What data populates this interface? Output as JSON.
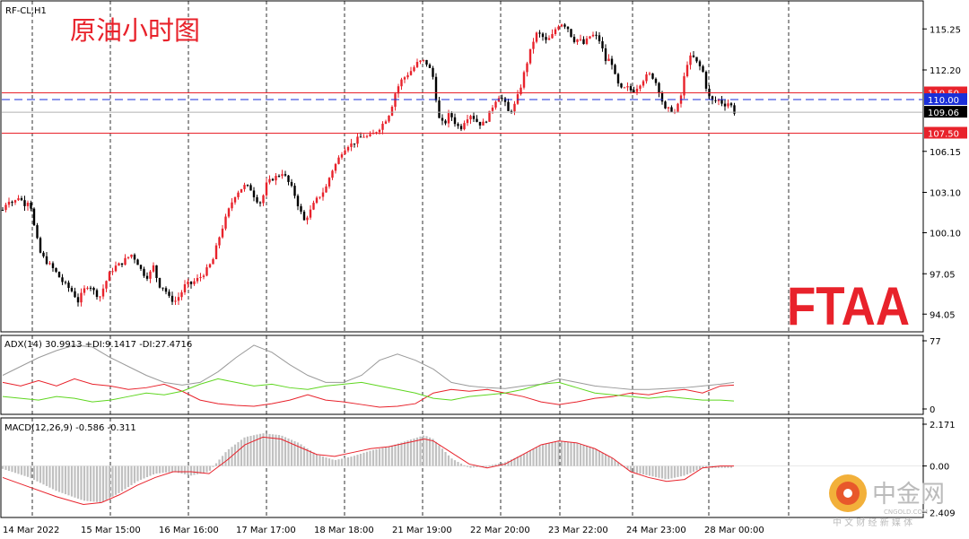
{
  "header": {
    "symbol_label": "RF-CL,H1",
    "chart_title": "原油小时图"
  },
  "watermark": {
    "brand": "FTAA",
    "brand_color": "#e8222b",
    "site_name": "中金网",
    "site_domain": "CNGOLD.COM",
    "site_tagline": "中 文 财 经 新 媒 体"
  },
  "chart_data": [
    {
      "type": "candlestick",
      "panel": "main",
      "ylim": [
        93.0,
        117.0
      ],
      "y_ticks": [
        "115.25",
        "112.20",
        "106.15",
        "103.10",
        "100.10",
        "97.05",
        "94.05"
      ],
      "y_tick_values": [
        115.25,
        112.2,
        106.15,
        103.1,
        100.1,
        97.05,
        94.05
      ],
      "x_tick_labels": [
        "14 Mar 2022",
        "15 Mar 15:00",
        "16 Mar 16:00",
        "17 Mar 17:00",
        "18 Mar 18:00",
        "21 Mar 19:00",
        "22 Mar 20:00",
        "23 Mar 22:00",
        "24 Mar 23:00",
        "28 Mar 00:00"
      ],
      "grid": "vertical-dashed",
      "close_path": [
        [
          0,
          101.8
        ],
        [
          6,
          102.6
        ],
        [
          12,
          102.3
        ],
        [
          18,
          102.8
        ],
        [
          24,
          102.2
        ],
        [
          30,
          102.6
        ],
        [
          36,
          100.2
        ],
        [
          42,
          98.6
        ],
        [
          48,
          98.0
        ],
        [
          54,
          97.6
        ],
        [
          60,
          97.1
        ],
        [
          66,
          96.5
        ],
        [
          72,
          96.1
        ],
        [
          78,
          95.7
        ],
        [
          84,
          95.0
        ],
        [
          90,
          95.8
        ],
        [
          96,
          96.3
        ],
        [
          102,
          95.7
        ],
        [
          108,
          95.3
        ],
        [
          114,
          96.3
        ],
        [
          120,
          97.2
        ],
        [
          126,
          97.6
        ],
        [
          132,
          97.8
        ],
        [
          138,
          98.2
        ],
        [
          144,
          98.5
        ],
        [
          150,
          97.9
        ],
        [
          156,
          97.1
        ],
        [
          162,
          96.8
        ],
        [
          168,
          97.6
        ],
        [
          174,
          96.2
        ],
        [
          180,
          96.0
        ],
        [
          186,
          95.2
        ],
        [
          192,
          95.0
        ],
        [
          198,
          95.5
        ],
        [
          204,
          96.3
        ],
        [
          210,
          96.3
        ],
        [
          216,
          96.6
        ],
        [
          222,
          96.9
        ],
        [
          228,
          97.4
        ],
        [
          234,
          98.0
        ],
        [
          240,
          99.5
        ],
        [
          246,
          100.7
        ],
        [
          252,
          101.8
        ],
        [
          258,
          102.8
        ],
        [
          264,
          103.3
        ],
        [
          270,
          103.6
        ],
        [
          276,
          103.4
        ],
        [
          282,
          102.6
        ],
        [
          288,
          102.3
        ],
        [
          294,
          103.7
        ],
        [
          300,
          104.1
        ],
        [
          306,
          104.3
        ],
        [
          312,
          104.6
        ],
        [
          318,
          103.9
        ],
        [
          324,
          103.2
        ],
        [
          330,
          102.0
        ],
        [
          336,
          101.0
        ],
        [
          342,
          101.6
        ],
        [
          348,
          102.4
        ],
        [
          354,
          102.9
        ],
        [
          360,
          103.4
        ],
        [
          366,
          104.6
        ],
        [
          372,
          105.3
        ],
        [
          378,
          106.1
        ],
        [
          384,
          106.6
        ],
        [
          390,
          106.7
        ],
        [
          396,
          107.1
        ],
        [
          402,
          107.3
        ],
        [
          408,
          107.2
        ],
        [
          414,
          107.5
        ],
        [
          420,
          107.9
        ],
        [
          426,
          108.4
        ],
        [
          432,
          109.1
        ],
        [
          438,
          110.6
        ],
        [
          444,
          111.4
        ],
        [
          450,
          111.8
        ],
        [
          456,
          112.2
        ],
        [
          462,
          112.7
        ],
        [
          468,
          112.9
        ],
        [
          474,
          112.6
        ],
        [
          480,
          111.6
        ],
        [
          486,
          108.6
        ],
        [
          492,
          108.1
        ],
        [
          498,
          109.0
        ],
        [
          504,
          108.3
        ],
        [
          510,
          107.8
        ],
        [
          516,
          108.6
        ],
        [
          522,
          108.9
        ],
        [
          528,
          108.4
        ],
        [
          534,
          108.1
        ],
        [
          540,
          108.6
        ],
        [
          546,
          109.5
        ],
        [
          552,
          110.3
        ],
        [
          558,
          110.0
        ],
        [
          564,
          109.0
        ],
        [
          570,
          109.5
        ],
        [
          576,
          110.6
        ],
        [
          582,
          112.2
        ],
        [
          588,
          113.6
        ],
        [
          594,
          114.9
        ],
        [
          600,
          114.8
        ],
        [
          606,
          114.3
        ],
        [
          612,
          114.7
        ],
        [
          618,
          115.5
        ],
        [
          624,
          115.7
        ],
        [
          630,
          115.3
        ],
        [
          636,
          114.4
        ],
        [
          642,
          114.5
        ],
        [
          648,
          114.1
        ],
        [
          654,
          114.7
        ],
        [
          660,
          114.8
        ],
        [
          666,
          114.3
        ],
        [
          672,
          112.9
        ],
        [
          678,
          113.0
        ],
        [
          684,
          111.3
        ],
        [
          690,
          110.7
        ],
        [
          696,
          110.9
        ],
        [
          702,
          110.6
        ],
        [
          708,
          111.0
        ],
        [
          714,
          111.5
        ],
        [
          720,
          111.9
        ],
        [
          726,
          111.6
        ],
        [
          732,
          110.6
        ],
        [
          738,
          109.2
        ],
        [
          744,
          109.3
        ],
        [
          750,
          109.0
        ],
        [
          756,
          110.3
        ],
        [
          762,
          112.6
        ],
        [
          768,
          113.3
        ],
        [
          774,
          112.7
        ],
        [
          780,
          112.2
        ],
        [
          786,
          110.3
        ],
        [
          792,
          109.8
        ],
        [
          798,
          110.0
        ],
        [
          804,
          109.6
        ],
        [
          810,
          109.8
        ],
        [
          816,
          109.0
        ]
      ],
      "hlines": [
        {
          "label": "110.50",
          "value": 110.5,
          "color": "#e8222b",
          "style": "solid"
        },
        {
          "label": "110.00",
          "value": 110.0,
          "color": "#1a2fd8",
          "style": "dashed"
        },
        {
          "label": "109.06",
          "value": 109.06,
          "color": "#b0b0b0",
          "style": "solid"
        },
        {
          "label": "107.50",
          "value": 107.5,
          "color": "#e8222b",
          "style": "solid"
        }
      ],
      "colors": {
        "bull": "#e8222b",
        "bear": "#000000"
      }
    },
    {
      "type": "line",
      "panel": "adx",
      "title": "ADX(14) 30.9913 +DI:9.1417 -DI:27.4716",
      "ylim": [
        0,
        77
      ],
      "y_ticks": [
        "77",
        "0"
      ],
      "y_tick_values": [
        77,
        0
      ],
      "series": [
        {
          "color": "#9a9a9a",
          "x": [
            0,
            20,
            40,
            60,
            80,
            100,
            120,
            140,
            160,
            180,
            200,
            220,
            240,
            260,
            280,
            300,
            320,
            340,
            360,
            380,
            400,
            420,
            440,
            460,
            480,
            500,
            520,
            540,
            560,
            580,
            600,
            620,
            640,
            660,
            680,
            700,
            720,
            740,
            760,
            780,
            800,
            815
          ],
          "y": [
            38,
            48,
            58,
            66,
            72,
            70,
            58,
            48,
            38,
            30,
            27,
            30,
            42,
            58,
            72,
            64,
            50,
            38,
            30,
            30,
            38,
            55,
            62,
            55,
            45,
            30,
            26,
            24,
            23,
            26,
            28,
            34,
            30,
            26,
            24,
            22,
            22,
            23,
            24,
            26,
            28,
            30
          ]
        },
        {
          "color": "#e8222b",
          "x": [
            0,
            20,
            40,
            60,
            80,
            100,
            120,
            140,
            160,
            180,
            200,
            220,
            240,
            260,
            280,
            300,
            320,
            340,
            360,
            380,
            400,
            420,
            440,
            460,
            480,
            500,
            520,
            540,
            560,
            580,
            600,
            620,
            640,
            660,
            680,
            700,
            720,
            740,
            760,
            780,
            800,
            815
          ],
          "y": [
            30,
            26,
            32,
            26,
            34,
            28,
            26,
            22,
            24,
            28,
            20,
            10,
            6,
            4,
            3,
            6,
            10,
            16,
            10,
            8,
            5,
            2,
            3,
            6,
            18,
            22,
            20,
            22,
            18,
            14,
            8,
            5,
            8,
            12,
            14,
            18,
            16,
            20,
            22,
            18,
            26,
            27
          ]
        },
        {
          "color": "#5fd620",
          "x": [
            0,
            20,
            40,
            60,
            80,
            100,
            120,
            140,
            160,
            180,
            200,
            220,
            240,
            260,
            280,
            300,
            320,
            340,
            360,
            380,
            400,
            420,
            440,
            460,
            480,
            500,
            520,
            540,
            560,
            580,
            600,
            620,
            640,
            660,
            680,
            700,
            720,
            740,
            760,
            780,
            800,
            815
          ],
          "y": [
            14,
            12,
            10,
            14,
            12,
            8,
            10,
            14,
            18,
            16,
            20,
            28,
            34,
            30,
            26,
            28,
            24,
            22,
            26,
            28,
            30,
            26,
            22,
            18,
            12,
            10,
            14,
            16,
            18,
            22,
            28,
            30,
            24,
            18,
            16,
            14,
            12,
            14,
            12,
            10,
            10,
            9
          ]
        }
      ]
    },
    {
      "type": "bar+line",
      "panel": "macd",
      "title": "MACD(12,26,9) -0.586 -0.311",
      "ylim": [
        -2.49,
        2.171
      ],
      "y_ticks": [
        "2.171",
        "0.00",
        "2.409"
      ],
      "y_tick_values": [
        2.171,
        0.0,
        -2.409
      ],
      "histogram_color": "#c0c0c0",
      "signal_color": "#e8222b",
      "histogram_path": [
        [
          0,
          -0.15
        ],
        [
          30,
          -0.6
        ],
        [
          60,
          -1.3
        ],
        [
          90,
          -1.8
        ],
        [
          110,
          -1.9
        ],
        [
          130,
          -1.4
        ],
        [
          150,
          -0.8
        ],
        [
          170,
          -0.4
        ],
        [
          190,
          -0.3
        ],
        [
          210,
          -0.5
        ],
        [
          230,
          -0.3
        ],
        [
          250,
          0.8
        ],
        [
          270,
          1.5
        ],
        [
          290,
          1.7
        ],
        [
          310,
          1.6
        ],
        [
          330,
          1.2
        ],
        [
          350,
          0.6
        ],
        [
          370,
          0.3
        ],
        [
          390,
          0.5
        ],
        [
          410,
          0.8
        ],
        [
          430,
          1.0
        ],
        [
          450,
          1.3
        ],
        [
          470,
          1.6
        ],
        [
          480,
          1.4
        ],
        [
          500,
          0.4
        ],
        [
          520,
          -0.1
        ],
        [
          540,
          0.0
        ],
        [
          560,
          0.2
        ],
        [
          580,
          0.6
        ],
        [
          600,
          1.1
        ],
        [
          620,
          1.3
        ],
        [
          640,
          1.2
        ],
        [
          660,
          0.9
        ],
        [
          680,
          0.4
        ],
        [
          700,
          -0.3
        ],
        [
          720,
          -0.5
        ],
        [
          740,
          -0.7
        ],
        [
          760,
          -0.5
        ],
        [
          780,
          -0.1
        ],
        [
          800,
          -0.1
        ],
        [
          815,
          -0.1
        ]
      ],
      "signal_path": [
        [
          0,
          -0.6
        ],
        [
          30,
          -1.1
        ],
        [
          60,
          -1.6
        ],
        [
          90,
          -2.0
        ],
        [
          110,
          -1.9
        ],
        [
          130,
          -1.5
        ],
        [
          150,
          -1.0
        ],
        [
          170,
          -0.6
        ],
        [
          190,
          -0.3
        ],
        [
          210,
          -0.3
        ],
        [
          230,
          -0.4
        ],
        [
          250,
          0.3
        ],
        [
          270,
          1.1
        ],
        [
          290,
          1.5
        ],
        [
          310,
          1.4
        ],
        [
          330,
          1.0
        ],
        [
          350,
          0.6
        ],
        [
          370,
          0.5
        ],
        [
          390,
          0.7
        ],
        [
          410,
          0.9
        ],
        [
          430,
          1.0
        ],
        [
          450,
          1.2
        ],
        [
          470,
          1.4
        ],
        [
          480,
          1.3
        ],
        [
          500,
          0.7
        ],
        [
          520,
          0.1
        ],
        [
          540,
          -0.1
        ],
        [
          560,
          0.1
        ],
        [
          580,
          0.6
        ],
        [
          600,
          1.1
        ],
        [
          620,
          1.3
        ],
        [
          640,
          1.2
        ],
        [
          660,
          0.9
        ],
        [
          680,
          0.4
        ],
        [
          700,
          -0.3
        ],
        [
          720,
          -0.6
        ],
        [
          740,
          -0.8
        ],
        [
          760,
          -0.7
        ],
        [
          780,
          -0.1
        ],
        [
          800,
          0.0
        ],
        [
          815,
          0.0
        ]
      ]
    }
  ]
}
